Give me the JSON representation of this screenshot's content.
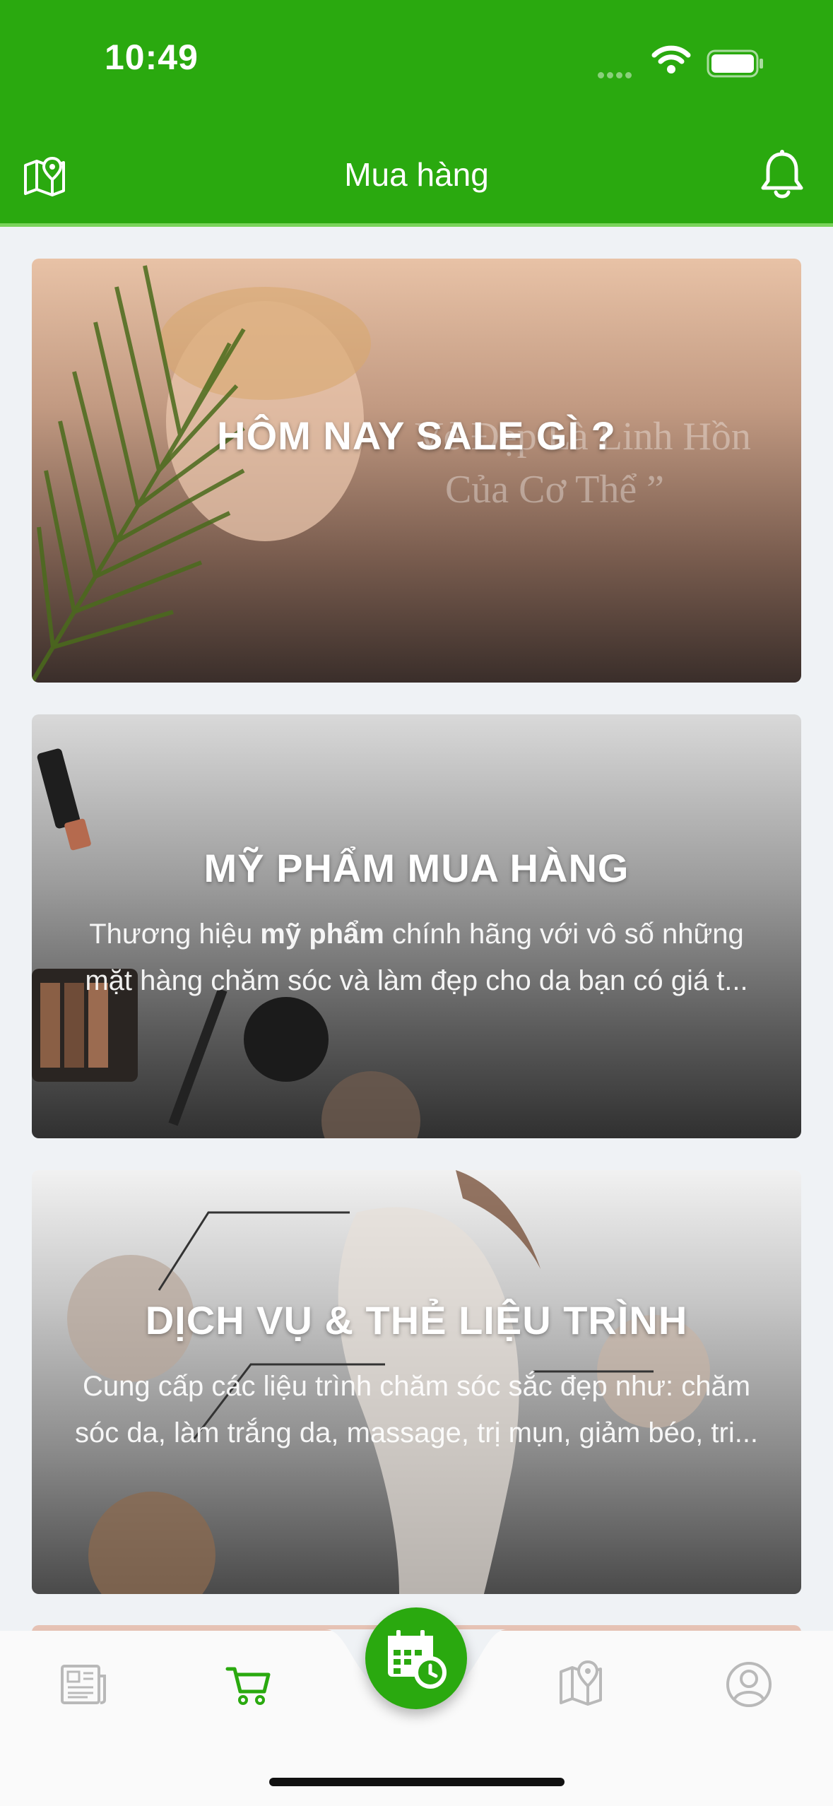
{
  "status": {
    "time": "10:49"
  },
  "header": {
    "title": "Mua hàng"
  },
  "cards": [
    {
      "title": "HÔM NAY SALE GÌ ?",
      "image_text_line1": "Vẻ Đẹp Là Linh Hồn",
      "image_text_line2": "Của Cơ Thể ”"
    },
    {
      "title": "MỸ PHẨM MUA HÀNG",
      "desc_prefix": "Thương hiệu ",
      "desc_bold": "mỹ phẩm",
      "desc_suffix": " chính hãng với vô số những mặt hàng chăm sóc và làm đẹp cho da bạn có giá t..."
    },
    {
      "title": "DỊCH VỤ & THẺ LIỆU TRÌNH",
      "desc": "Cung cấp các liệu trình chăm sóc sắc đẹp như: chăm sóc da, làm trắng da, massage, trị mụn, giảm béo, tri..."
    }
  ],
  "tabbar": {
    "active": "cart",
    "items": [
      "news-icon",
      "cart-icon",
      "calendar-clock-icon",
      "map-pin-icon",
      "profile-icon"
    ]
  },
  "colors": {
    "brand": "#2aa90f",
    "inactive_icon": "#b9b9b9"
  }
}
